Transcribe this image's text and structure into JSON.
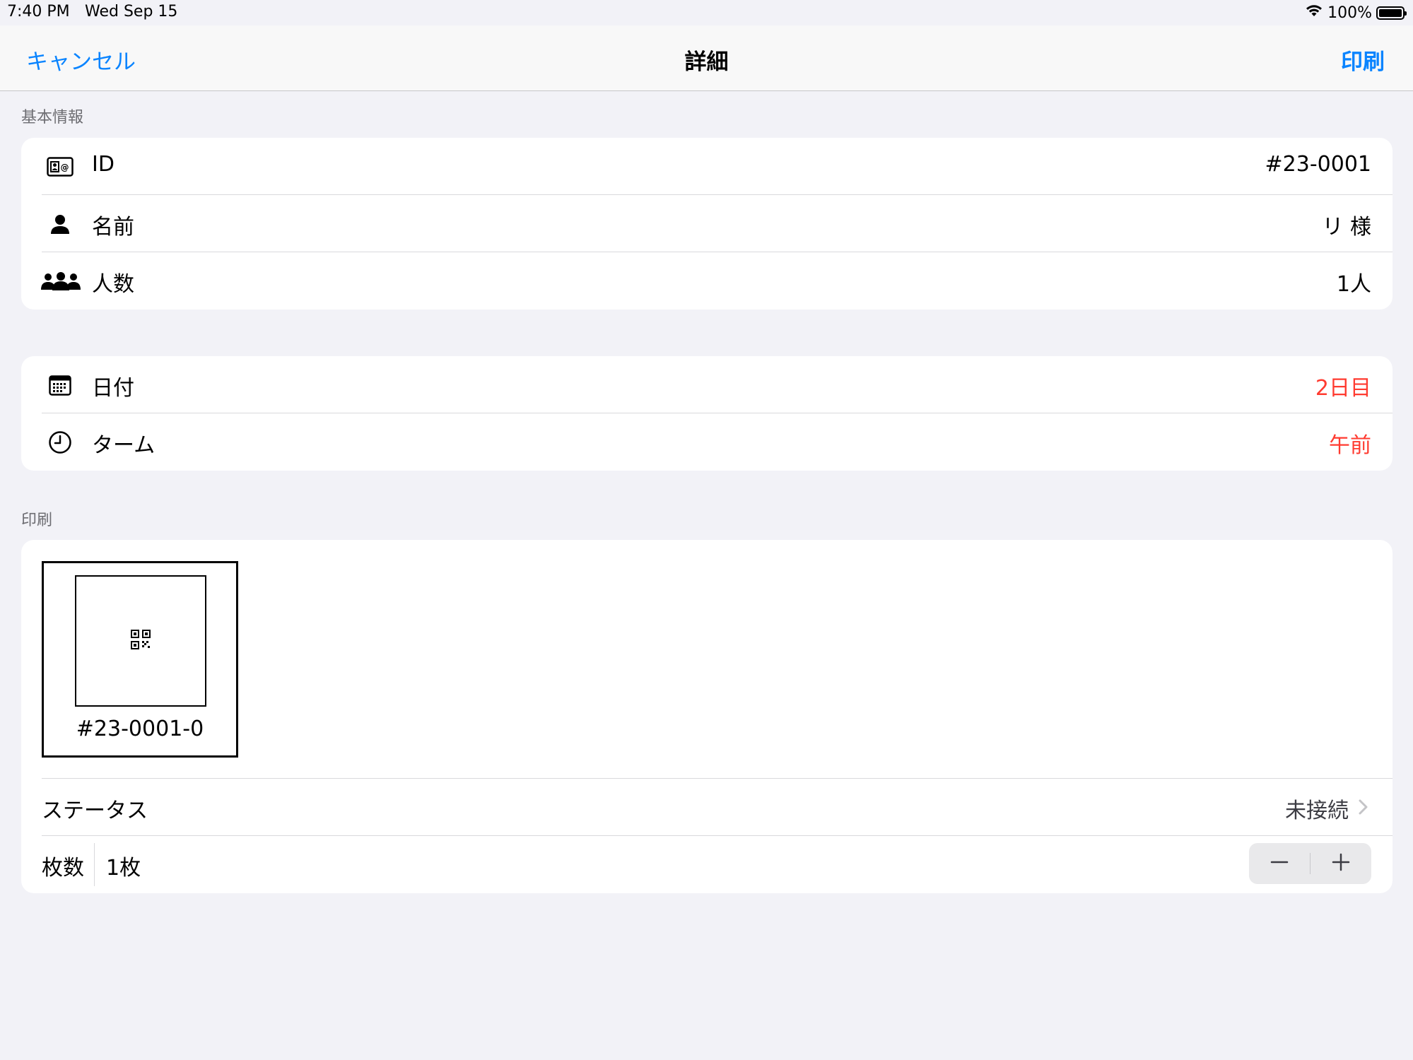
{
  "status_bar": {
    "time": "7:40 PM",
    "date": "Wed Sep 15",
    "battery": "100%",
    "icons": [
      "wifi-icon",
      "battery-icon"
    ]
  },
  "nav": {
    "cancel_label": "キャンセル",
    "title": "詳細",
    "print_label": "印刷",
    "accent_color": "#0a84ff"
  },
  "basic_info": {
    "header": "基本情報",
    "rows": [
      {
        "icon": "id-card-icon",
        "label": "ID",
        "value": "#23-0001"
      },
      {
        "icon": "person-icon",
        "label": "名前",
        "value": "リ 様"
      },
      {
        "icon": "people-icon",
        "label": "人数",
        "value": "1人"
      }
    ]
  },
  "schedule": {
    "rows": [
      {
        "icon": "calendar-icon",
        "label": "日付",
        "value": "2日目"
      },
      {
        "icon": "clock-icon",
        "label": "ターム",
        "value": "午前"
      }
    ],
    "value_color": "#ff3b30"
  },
  "print": {
    "header": "印刷",
    "label_preview": {
      "icon": "qrcode-icon",
      "code": "#23-0001-0"
    },
    "status": {
      "label": "ステータス",
      "value": "未接続",
      "icon": "chevron-right-icon"
    },
    "count": {
      "label": "枚数",
      "value": "1枚",
      "stepper_icons": [
        "minus-icon",
        "plus-icon"
      ]
    }
  }
}
